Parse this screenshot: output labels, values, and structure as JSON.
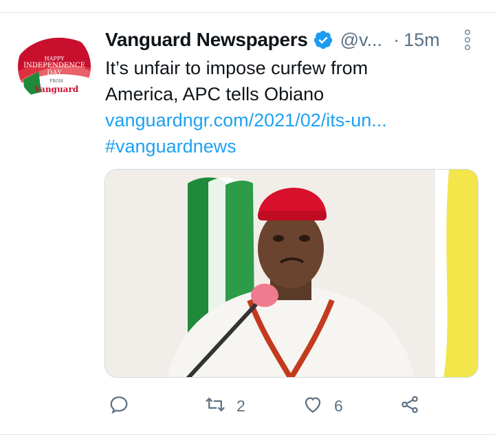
{
  "tweet": {
    "author_name": "Vanguard Newspapers",
    "handle": "@v...",
    "separator": "·",
    "time": "15m",
    "text_line1": "It’s unfair to impose curfew from",
    "text_line2": "America, APC tells Obiano",
    "link": "vanguardngr.com/2021/02/its-un...",
    "hashtag": "#vanguardnews",
    "avatar_text": {
      "line1": "HAPPY",
      "line2": "INDEPENDENCE",
      "line3": "DAY",
      "line4": "FROM",
      "brand": "Vanguard"
    }
  },
  "actions": {
    "reply_icon": "reply-icon",
    "retweet_icon": "retweet-icon",
    "retweet_count": "2",
    "like_icon": "heart-icon",
    "like_count": "6",
    "share_icon": "share-icon"
  },
  "colors": {
    "link": "#1da1f2",
    "verified": "#1d9bf0",
    "muted": "#5b7083",
    "cap_red": "#d8102b",
    "flag_green": "#1f8a3a",
    "flag_yellow": "#f2e64a"
  }
}
